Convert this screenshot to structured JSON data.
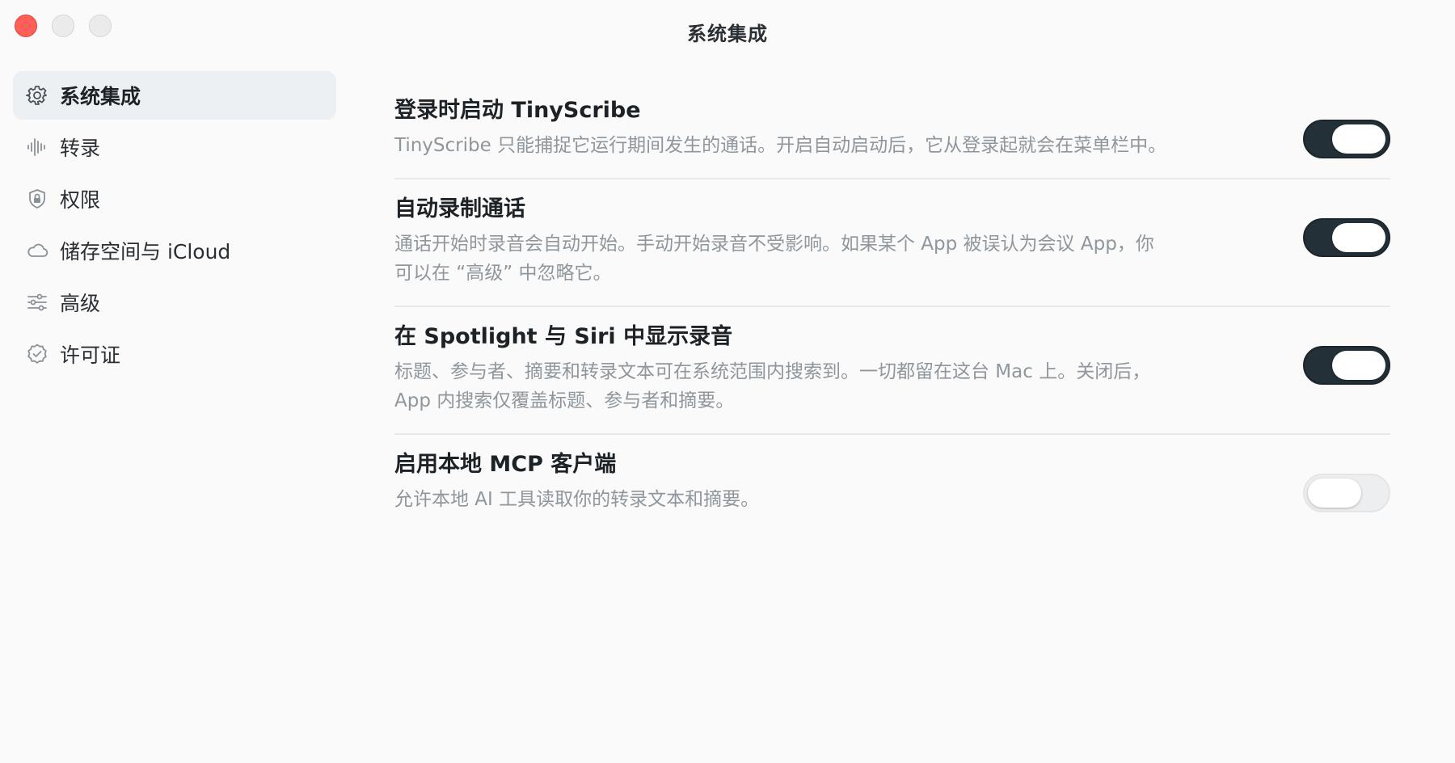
{
  "window": {
    "title": "系统集成"
  },
  "sidebar": {
    "items": [
      {
        "label": "系统集成",
        "icon": "gear-icon",
        "active": true
      },
      {
        "label": "转录",
        "icon": "waveform-icon",
        "active": false
      },
      {
        "label": "权限",
        "icon": "lock-shield-icon",
        "active": false
      },
      {
        "label": "储存空间与 iCloud",
        "icon": "cloud-icon",
        "active": false
      },
      {
        "label": "高级",
        "icon": "sliders-icon",
        "active": false
      },
      {
        "label": "许可证",
        "icon": "checkmark-seal-icon",
        "active": false
      }
    ]
  },
  "settings": [
    {
      "title": "登录时启动 TinyScribe",
      "description": "TinyScribe 只能捕捉它运行期间发生的通话。开启自动启动后，它从登录起就会在菜单栏中。",
      "enabled": true
    },
    {
      "title": "自动录制通话",
      "description": "通话开始时录音会自动开始。手动开始录音不受影响。如果某个 App 被误认为会议 App，你可以在 “高级” 中忽略它。",
      "enabled": true
    },
    {
      "title": "在 Spotlight 与 Siri 中显示录音",
      "description": "标题、参与者、摘要和转录文本可在系统范围内搜索到。一切都留在这台 Mac 上。关闭后，App 内搜索仅覆盖标题、参与者和摘要。",
      "enabled": true
    },
    {
      "title": "启用本地 MCP 客户端",
      "description": "允许本地 AI 工具读取你的转录文本和摘要。",
      "enabled": false
    }
  ],
  "colors": {
    "toggle_on": "#243037",
    "toggle_off": "#eceeef",
    "active_sidebar_bg": "#edf0f2",
    "close_button": "#fe5f57"
  }
}
